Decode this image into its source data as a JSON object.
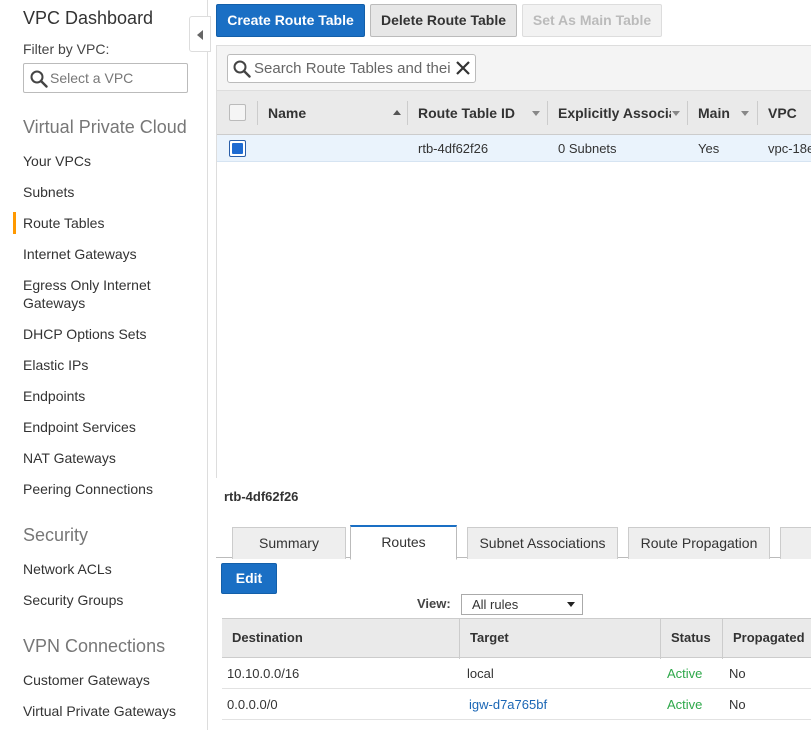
{
  "sidebar": {
    "title": "VPC Dashboard",
    "filter_label": "Filter by VPC:",
    "filter_placeholder": "Select a VPC",
    "sections": [
      {
        "label": "Virtual Private Cloud"
      },
      {
        "label": "Security"
      },
      {
        "label": "VPN Connections"
      }
    ],
    "items": [
      {
        "label": "Your VPCs"
      },
      {
        "label": "Subnets"
      },
      {
        "label": "Route Tables"
      },
      {
        "label": "Internet Gateways"
      },
      {
        "label": "Egress Only Internet Gateways"
      },
      {
        "label": "DHCP Options Sets"
      },
      {
        "label": "Elastic IPs"
      },
      {
        "label": "Endpoints"
      },
      {
        "label": "Endpoint Services"
      },
      {
        "label": "NAT Gateways"
      },
      {
        "label": "Peering Connections"
      },
      {
        "label": "Network ACLs"
      },
      {
        "label": "Security Groups"
      },
      {
        "label": "Customer Gateways"
      },
      {
        "label": "Virtual Private Gateways"
      }
    ],
    "active_item": "Route Tables",
    "accent_color": "#ff9900"
  },
  "toolbar": {
    "create_label": "Create Route Table",
    "delete_label": "Delete Route Table",
    "set_main_label": "Set As Main Table"
  },
  "search": {
    "placeholder": "Search Route Tables and thei"
  },
  "table": {
    "columns": [
      "Name",
      "Route Table ID",
      "Explicitly Associat",
      "Main",
      "VPC"
    ],
    "rows": [
      {
        "selected": true,
        "name": "",
        "route_table_id": "rtb-4df62f26",
        "explicit": "0 Subnets",
        "main": "Yes",
        "vpc": "vpc-18e"
      }
    ]
  },
  "detail": {
    "title": "rtb-4df62f26",
    "tabs": [
      "Summary",
      "Routes",
      "Subnet Associations",
      "Route Propagation"
    ],
    "active_tab": "Routes",
    "edit_label": "Edit",
    "view_label": "View:",
    "view_value": "All rules",
    "routes": {
      "columns": [
        "Destination",
        "Target",
        "Status",
        "Propagated"
      ],
      "rows": [
        {
          "destination": "10.10.0.0/16",
          "target": "local",
          "status": "Active",
          "propagated": "No"
        },
        {
          "destination": "0.0.0.0/0",
          "target": "igw-d7a765bf",
          "status": "Active",
          "propagated": "No"
        }
      ]
    }
  },
  "colors": {
    "primary_button": "#1a6fc4",
    "status_active": "#2ea84a",
    "link": "#1a66b5",
    "selected_row": "#eaf3fc"
  }
}
